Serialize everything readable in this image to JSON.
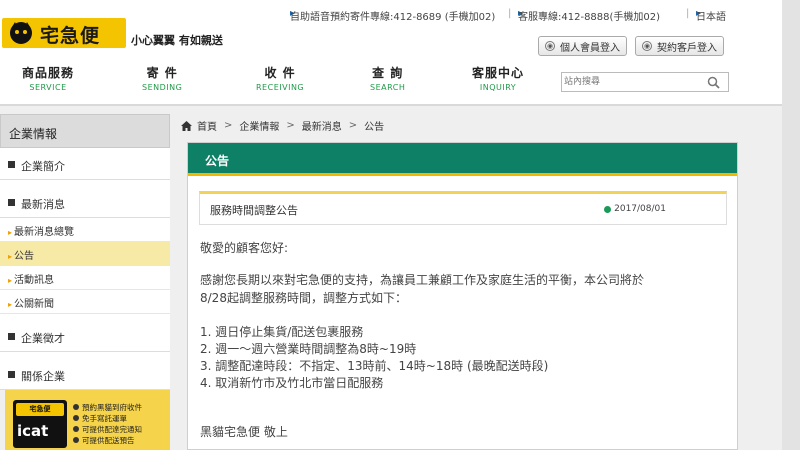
{
  "brand": {
    "logo_text": "宅急便",
    "slogan": "小心翼翼 有如親送"
  },
  "topline": {
    "voice": "自助語音預約寄件專線:412-8689 (手機加02)",
    "service": "客服專線:412-8888(手機加02)",
    "language": "日本語"
  },
  "member_buttons": {
    "personal": "個人會員登入",
    "contract": "契約客戶登入"
  },
  "nav": [
    {
      "zh": "商品服務",
      "en": "SERVICE"
    },
    {
      "zh": "寄 件",
      "en": "SENDING"
    },
    {
      "zh": "收 件",
      "en": "RECEIVING"
    },
    {
      "zh": "查 詢",
      "en": "SEARCH"
    },
    {
      "zh": "客服中心",
      "en": "INQUIRY"
    }
  ],
  "search": {
    "placeholder": "站內搜尋"
  },
  "sidebar": {
    "title": "企業情報",
    "sections": [
      {
        "label": "企業簡介"
      },
      {
        "label": "最新消息"
      },
      {
        "label": "企業徵才"
      },
      {
        "label": "關係企業"
      }
    ],
    "news_sub": [
      {
        "label": "最新消息總覽"
      },
      {
        "label": "公告",
        "active": true
      },
      {
        "label": "活動訊息"
      },
      {
        "label": "公關新聞"
      }
    ]
  },
  "icat": {
    "badge": "宅急便",
    "word": "icat",
    "items": [
      "預約黑貓到府收件",
      "免手寫託運單",
      "可提供配達完通知",
      "可提供配送預告"
    ]
  },
  "breadcrumb": [
    "首頁",
    "企業情報",
    "最新消息",
    "公告"
  ],
  "panel": {
    "heading": "公告",
    "notice_title": "服務時間調整公告",
    "notice_date": "2017/08/01",
    "greeting": "敬愛的顧客您好:",
    "para_line1": "感謝您長期以來對宅急便的支持，為讓員工兼顧工作及家庭生活的平衡，本公司將於",
    "para_line2": "8/28起調整服務時間，調整方式如下：",
    "list": [
      "1. 週日停止集貨/配送包裹服務",
      "2. 週一～週六營業時間調整為8時~19時",
      "3. 調整配達時段：不指定、13時前、14時~18時 (最晚配送時段)",
      "4. 取消新竹市及竹北市當日配服務"
    ],
    "signature": "黑貓宅急便 敬上"
  },
  "colors": {
    "brand_yellow": "#f5c400",
    "panel_green": "#0d8066",
    "nav_green": "#1f9a48",
    "active_bg": "#f7e9a6"
  }
}
